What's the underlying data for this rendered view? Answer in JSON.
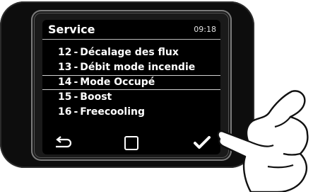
{
  "screen": {
    "title": "Service",
    "time": "09:18"
  },
  "menu": {
    "items": [
      {
        "number": "12",
        "label": "Décalage des flux",
        "selected": false
      },
      {
        "number": "13",
        "label": "Débit mode incendie",
        "selected": false
      },
      {
        "number": "14",
        "label": "Mode Occupé",
        "selected": true
      },
      {
        "number": "15",
        "label": "Boost",
        "selected": false
      },
      {
        "number": "16",
        "label": "Freecooling",
        "selected": false
      }
    ]
  },
  "softkeys": {
    "left": "back-arrow-icon",
    "middle": "square-icon",
    "right": "checkmark-icon"
  },
  "colors": {
    "device": "#0d0d0d",
    "screen": "#000000",
    "text": "#ffffff",
    "divider": "#d0d0d0"
  }
}
